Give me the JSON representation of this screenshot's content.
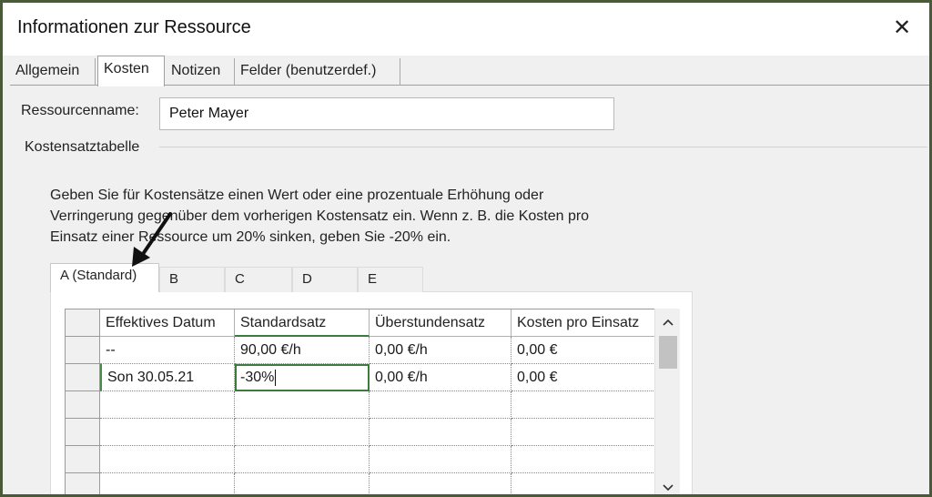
{
  "window": {
    "title": "Informationen zur Ressource",
    "close_glyph": "✕"
  },
  "tabs": [
    {
      "label": "Allgemein",
      "active": false
    },
    {
      "label": "Kosten",
      "active": true
    },
    {
      "label": "Notizen",
      "active": false
    },
    {
      "label": "Felder (benutzerdef.)",
      "active": false
    }
  ],
  "resource": {
    "name_label": "Ressourcenname:",
    "name_value": "Peter Mayer"
  },
  "cost_table": {
    "group_label": "Kostensatztabelle",
    "info_lines": [
      "Geben Sie für Kostensätze einen Wert oder eine prozentuale Erhöhung oder",
      "Verringerung gegenüber dem vorherigen Kostensatz ein. Wenn z. B. die Kosten pro",
      "Einsatz einer Ressource um 20% sinken, geben Sie -20% ein."
    ],
    "rate_tabs": [
      {
        "label": "A (Standard)",
        "active": true
      },
      {
        "label": "B",
        "active": false
      },
      {
        "label": "C",
        "active": false
      },
      {
        "label": "D",
        "active": false
      },
      {
        "label": "E",
        "active": false
      }
    ],
    "columns": [
      "Effektives Datum",
      "Standardsatz",
      "Überstundensatz",
      "Kosten pro Einsatz"
    ],
    "rows": [
      [
        "--",
        "90,00 €/h",
        "0,00 €/h",
        "0,00 €"
      ],
      [
        "Son 30.05.21",
        "-30%",
        "0,00 €/h",
        "0,00 €"
      ],
      [
        "",
        "",
        "",
        ""
      ],
      [
        "",
        "",
        "",
        ""
      ],
      [
        "",
        "",
        "",
        ""
      ],
      [
        "",
        "",
        "",
        ""
      ]
    ]
  },
  "icons": {
    "close": "close-icon",
    "annotation_arrow": "arrow-pointer-icon",
    "scroll_up": "chevron-up-icon",
    "scroll_down": "chevron-down-icon"
  },
  "scrollbar": {
    "up_glyph": "⌃",
    "down_glyph": "⌄"
  },
  "colors": {
    "frame_border": "#4a5a38",
    "selection": "#3d7a3d",
    "dialog_bg": "#f0f0f0"
  }
}
